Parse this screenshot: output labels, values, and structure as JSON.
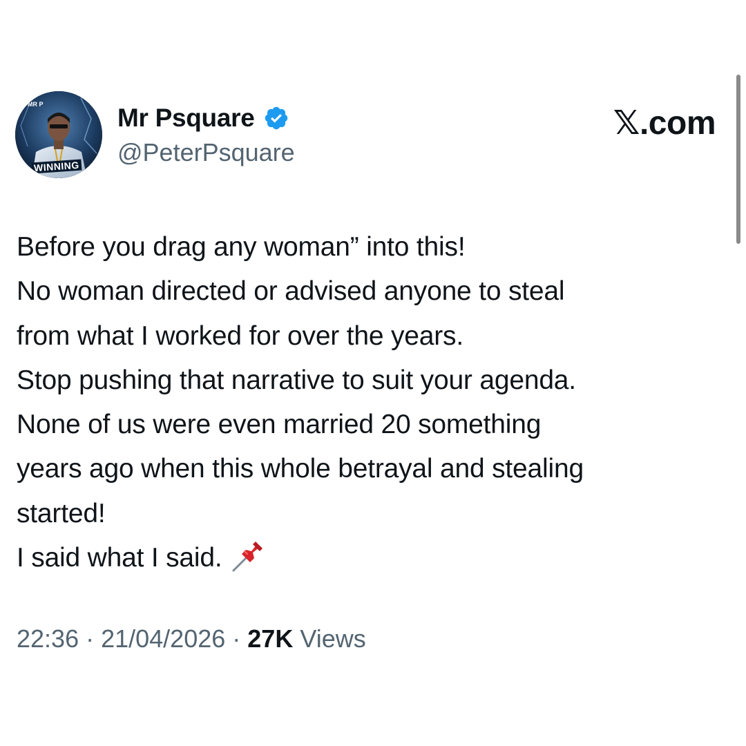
{
  "author": {
    "display_name": "Mr Psquare",
    "handle": "@PeterPsquare",
    "verified_icon": "verified-badge-icon",
    "avatar": {
      "top_left_text": "MR P",
      "banner_text": "WINNING"
    }
  },
  "brand": "𝕏.com",
  "tweet": {
    "lines": [
      "Before you drag any woman” into this!",
      "No woman directed or advised anyone to steal",
      "from what I worked for over the years.",
      "Stop pushing that narrative to suit your agenda.",
      "None of us were even married 20 something",
      "years ago when this whole betrayal and stealing",
      "started!",
      "I said what I said."
    ],
    "trailing_emoji_icon": "pushpin-icon"
  },
  "meta": {
    "time": "22:36",
    "separator": " · ",
    "date": "21/04/2026",
    "views_count": "27K",
    "views_label": "Views"
  },
  "colors": {
    "text": "#0f1419",
    "secondary": "#536471",
    "verified": "#1d9bf0",
    "background": "#ffffff"
  }
}
